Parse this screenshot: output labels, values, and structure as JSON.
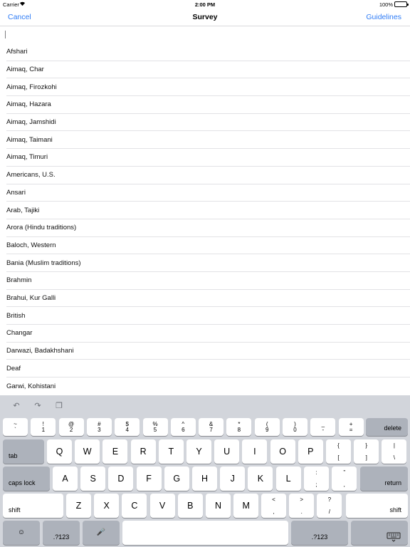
{
  "status_bar": {
    "carrier": "Carrier",
    "time": "2:00 PM",
    "battery_pct": "100%",
    "battery_level": 1.0
  },
  "nav": {
    "cancel": "Cancel",
    "title": "Survey",
    "guidelines": "Guidelines"
  },
  "search": {
    "value": "",
    "placeholder": ""
  },
  "list": {
    "items": [
      "Afshari",
      "Aimaq, Char",
      "Aimaq, Firozkohi",
      "Aimaq, Hazara",
      "Aimaq, Jamshidi",
      "Aimaq, Taimani",
      "Aimaq, Timuri",
      "Americans, U.S.",
      "Ansari",
      "Arab, Tajiki",
      "Arora (Hindu traditions)",
      "Baloch, Western",
      "Bania (Muslim traditions)",
      "Brahmin",
      "Brahui, Kur Galli",
      "British",
      "Changar",
      "Darwazi, Badakhshani",
      "Deaf",
      "Garwi, Kohistani"
    ]
  },
  "keyboard": {
    "tools": [
      "undo-icon",
      "redo-icon",
      "paste-icon"
    ],
    "number_row": [
      {
        "top": "~",
        "bot": "`"
      },
      {
        "top": "!",
        "bot": "1"
      },
      {
        "top": "@",
        "bot": "2"
      },
      {
        "top": "#",
        "bot": "3"
      },
      {
        "top": "$",
        "bot": "4"
      },
      {
        "top": "%",
        "bot": "5"
      },
      {
        "top": "^",
        "bot": "6"
      },
      {
        "top": "&",
        "bot": "7"
      },
      {
        "top": "*",
        "bot": "8"
      },
      {
        "top": "(",
        "bot": "9"
      },
      {
        "top": ")",
        "bot": "0"
      },
      {
        "top": "_",
        "bot": "-"
      },
      {
        "top": "+",
        "bot": "="
      }
    ],
    "delete": "delete",
    "tab": "tab",
    "row_q": [
      "Q",
      "W",
      "E",
      "R",
      "T",
      "Y",
      "U",
      "I",
      "O",
      "P"
    ],
    "row_q_extra": [
      {
        "top": "{",
        "bot": "["
      },
      {
        "top": "}",
        "bot": "]"
      },
      {
        "top": "|",
        "bot": "\\"
      }
    ],
    "caps_lock": "caps lock",
    "row_a": [
      "A",
      "S",
      "D",
      "F",
      "G",
      "H",
      "J",
      "K",
      "L"
    ],
    "row_a_extra": [
      {
        "top": ":",
        "bot": ";"
      },
      {
        "top": "”",
        "bot": ","
      }
    ],
    "return": "return",
    "shift": "shift",
    "row_z": [
      "Z",
      "X",
      "C",
      "V",
      "B",
      "N",
      "M"
    ],
    "row_z_extra": [
      {
        "top": "<",
        "bot": ","
      },
      {
        "top": ">",
        "bot": "."
      },
      {
        "top": "?",
        "bot": "/"
      }
    ],
    "emoji_icon": "emoji-icon",
    "numbers_label": ".?123",
    "mic_icon": "microphone-icon",
    "space": "",
    "hide_icon": "keyboard-hide-icon"
  }
}
